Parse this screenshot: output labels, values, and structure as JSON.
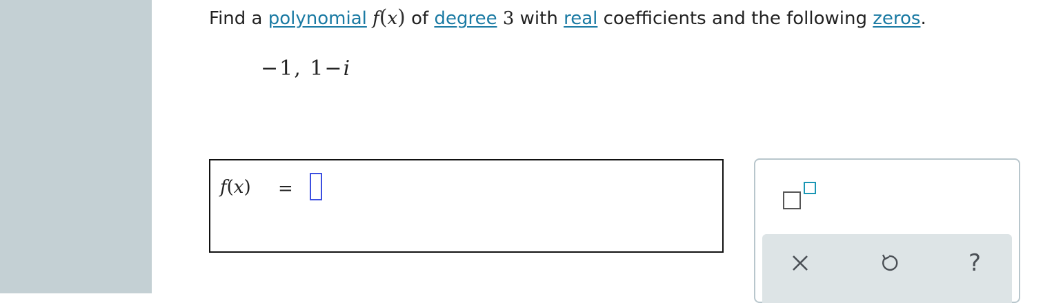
{
  "question": {
    "prefix": "Find a",
    "link_polynomial": "polynomial",
    "fn_name": "f",
    "paren_open": "(",
    "fn_var": "x",
    "paren_close": ")",
    "text_of": "of",
    "link_degree": "degree",
    "degree_value": "3",
    "text_with": "with",
    "link_real": "real",
    "text_middle": "coefficients and the following",
    "link_zeros": "zeros",
    "period": "."
  },
  "zeros": {
    "zero1": "−1",
    "separator": ",",
    "zero2_real": "1",
    "minus": "−",
    "zero2_imag": "i"
  },
  "answer": {
    "lhs_f": "f",
    "lhs_open": "(",
    "lhs_x": "x",
    "lhs_close": ")",
    "equals": "=",
    "input_value": ""
  },
  "tools": {
    "superscript_icon": "superscript-template-icon",
    "clear_icon": "x-icon",
    "undo_icon": "undo-icon",
    "help_icon": "question-mark-icon",
    "help_glyph": "?"
  },
  "colors": {
    "link": "#1a7aa3",
    "sidebar": "#c4d0d4",
    "input_border": "#3c4fe0",
    "superscript_accent": "#1a96b4",
    "actions_bg": "#dde4e6"
  }
}
